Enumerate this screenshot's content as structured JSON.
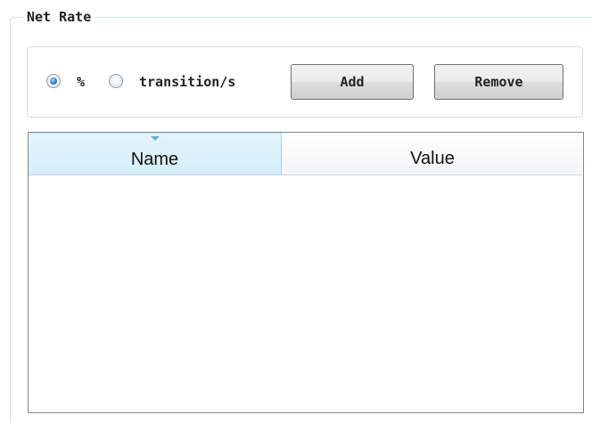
{
  "group": {
    "title": "Net Rate"
  },
  "options": {
    "unit_percent_label": "%",
    "unit_transition_label": "transition/s",
    "selected_unit": "%",
    "add_label": "Add",
    "remove_label": "Remove"
  },
  "table": {
    "columns": [
      "Name",
      "Value"
    ],
    "sorted_column": "Name",
    "rows": []
  },
  "colors": {
    "header_selected": "#d5eefa",
    "radio_checked": "#2b7fd4",
    "border": "#828790"
  }
}
